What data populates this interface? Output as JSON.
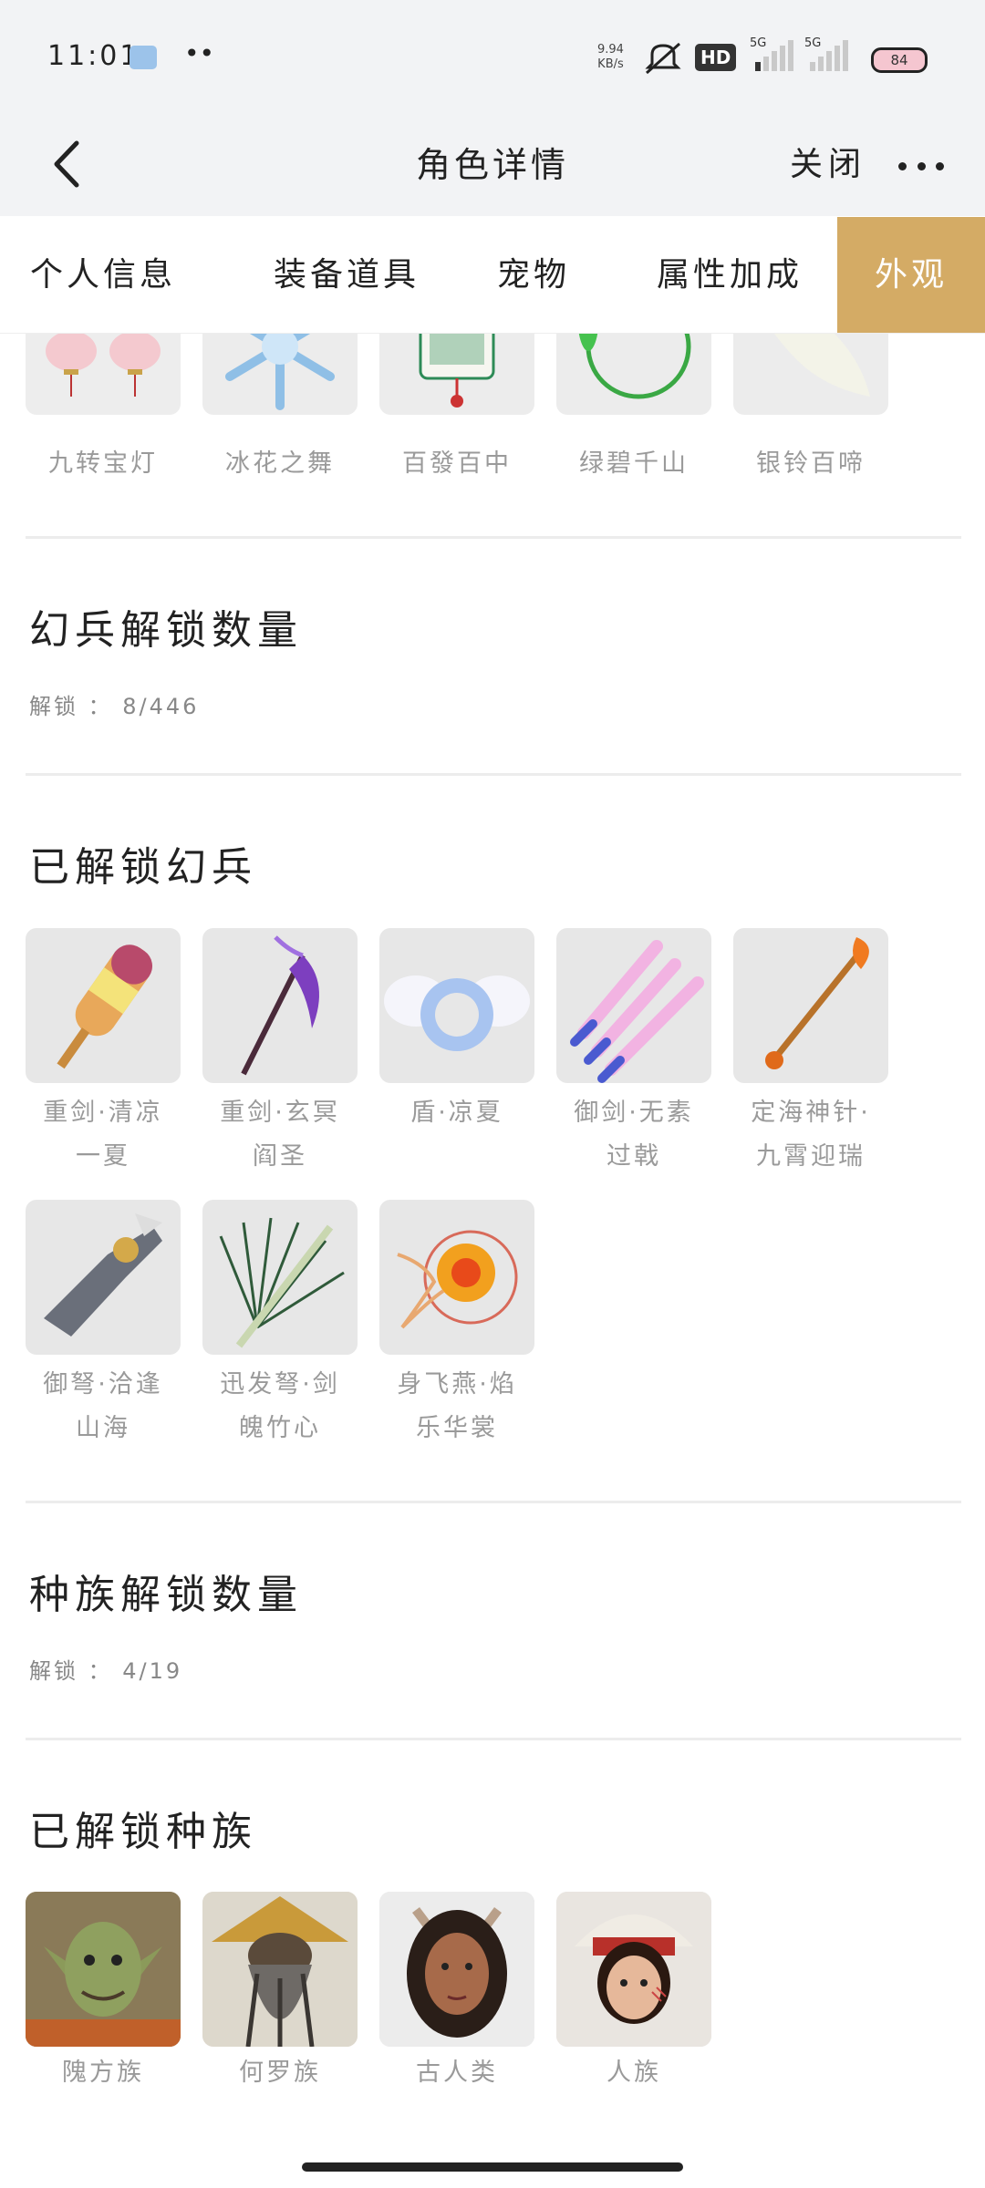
{
  "status_bar": {
    "time": "11:01",
    "net_speed_value": "9.94",
    "net_speed_unit": "KB/s",
    "hd_badge": "HD",
    "sim1": "5G",
    "sim2": "5G",
    "battery": "84"
  },
  "nav": {
    "title": "角色详情",
    "close_label": "关闭"
  },
  "tabs": [
    {
      "label": "个人信息",
      "active": false
    },
    {
      "label": "装备道具",
      "active": false
    },
    {
      "label": "宠物",
      "active": false
    },
    {
      "label": "属性加成",
      "active": false
    },
    {
      "label": "外观",
      "active": true
    }
  ],
  "top_items": [
    {
      "name": "九转宝灯"
    },
    {
      "name": "冰花之舞"
    },
    {
      "name": "百發百中"
    },
    {
      "name": "绿碧千山"
    },
    {
      "name": "银铃百啼"
    }
  ],
  "weapon_unlock": {
    "title": "幻兵解锁数量",
    "label": "解锁",
    "count": "8/446"
  },
  "unlocked_weapons": {
    "title": "已解锁幻兵",
    "items": [
      {
        "line1": "重剑·清凉",
        "line2": "一夏"
      },
      {
        "line1": "重剑·玄冥",
        "line2": "阎圣"
      },
      {
        "line1": "盾·凉夏",
        "line2": ""
      },
      {
        "line1": "御剑·无素",
        "line2": "过戟"
      },
      {
        "line1": "定海神针·",
        "line2": "九霄迎瑞"
      },
      {
        "line1": "御弩·洽逢",
        "line2": "山海"
      },
      {
        "line1": "迅发弩·剑",
        "line2": "魄竹心"
      },
      {
        "line1": "身飞燕·焰",
        "line2": "乐华裳"
      }
    ]
  },
  "race_unlock": {
    "title": "种族解锁数量",
    "label": "解锁",
    "count": "4/19"
  },
  "unlocked_races": {
    "title": "已解锁种族",
    "items": [
      {
        "name": "隗方族"
      },
      {
        "name": "何罗族"
      },
      {
        "name": "古人类"
      },
      {
        "name": "人族"
      }
    ]
  },
  "colors": {
    "active_tab": "#d4ab65",
    "page_bg": "#ffffff",
    "header_bg": "#f2f3f5"
  }
}
